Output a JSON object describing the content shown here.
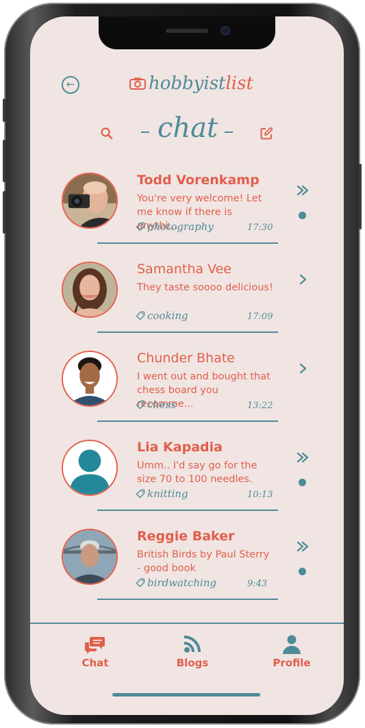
{
  "app": {
    "logo_main": "hobbyist",
    "logo_accent": "list",
    "page_title": "chat"
  },
  "colors": {
    "accent": "#e15e4c",
    "teal": "#4f8a98",
    "background": "#f0e5e2"
  },
  "icons": {
    "back": "back-arrow-icon",
    "search": "search-icon",
    "compose": "compose-icon",
    "tag": "tag-icon",
    "unread_chevron": "double-chevron-right-icon",
    "read_chevron": "chevron-right-icon"
  },
  "chats": [
    {
      "name": "Todd Vorenkamp",
      "preview": "You're very welcome! Let me know if there is anythi...",
      "tag": "photography",
      "time": "17:30",
      "unread": true
    },
    {
      "name": "Samantha Vee",
      "preview": "They taste soooo delicious!",
      "tag": "cooking",
      "time": "17:09",
      "unread": false
    },
    {
      "name": "Chunder Bhate",
      "preview": "I went out and bought that chess board you recomme...",
      "tag": "chess",
      "time": "13:22",
      "unread": false
    },
    {
      "name": "Lia Kapadia",
      "preview": "Umm.. I'd say go for the size 70 to 100 needles.",
      "tag": "knitting",
      "time": "10:13",
      "unread": true
    },
    {
      "name": "Reggie Baker",
      "preview": "British Birds by Paul Sterry - good book",
      "tag": "birdwatching",
      "time": "9:43",
      "unread": true
    }
  ],
  "tabs": [
    {
      "label": "Chat",
      "icon": "chat-bubbles-icon"
    },
    {
      "label": "Blogs",
      "icon": "rss-feed-icon"
    },
    {
      "label": "Profile",
      "icon": "person-icon"
    }
  ]
}
